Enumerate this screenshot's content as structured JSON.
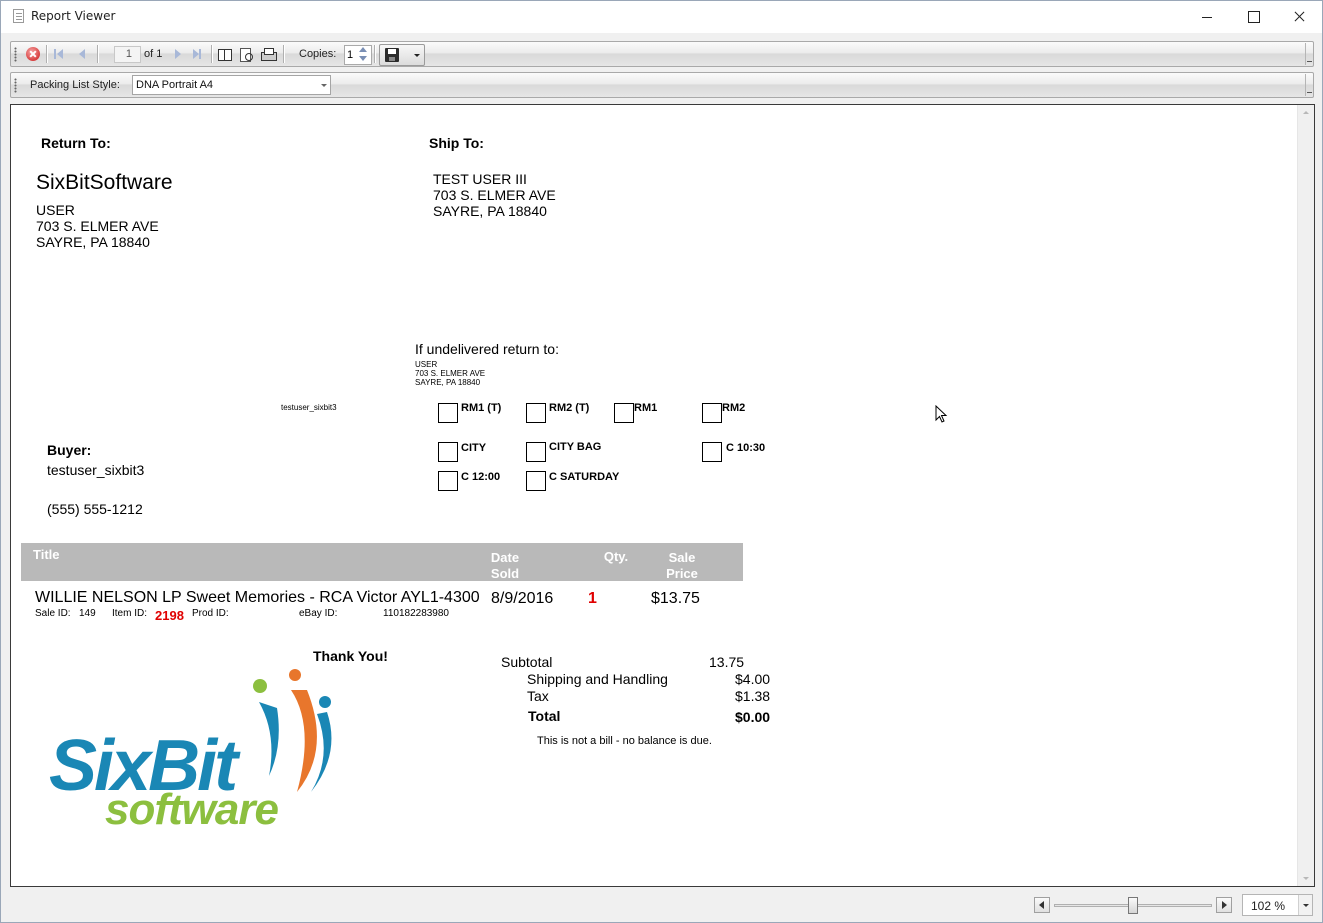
{
  "window": {
    "title": "Report Viewer"
  },
  "toolbar": {
    "page_current": "1",
    "page_of": "of 1",
    "copies_label": "Copies:",
    "copies_value": "1",
    "icons": [
      "stop-icon",
      "first-page-icon",
      "previous-page-icon",
      "next-page-icon",
      "last-page-icon",
      "table-of-contents-icon",
      "page-setup-icon",
      "print-icon",
      "save-icon"
    ]
  },
  "parameters": {
    "style_label": "Packing List Style:",
    "style_value": "DNA Portrait A4"
  },
  "report": {
    "return_to": {
      "heading": "Return To:",
      "company": "SixBitSoftware",
      "name": "USER",
      "street": "703 S. ELMER AVE",
      "city": "SAYRE, PA 18840"
    },
    "ship_to": {
      "heading": "Ship To:",
      "name": "TEST USER III",
      "street": "703 S. ELMER AVE",
      "city": "SAYRE, PA 18840"
    },
    "undelivered": {
      "heading": "If undelivered return to:",
      "name": "USER",
      "street": "703 S. ELMER AVE",
      "city": "SAYRE, PA 18840"
    },
    "buyer_userid_small": "testuser_sixbit3",
    "checkboxes": {
      "rm1t": "RM1 (T)",
      "rm2t": "RM2 (T)",
      "rm1": "RM1",
      "rm2": "RM2",
      "city": "CITY",
      "city_bag": "CITY BAG",
      "c1030": "C 10:30",
      "c1200": "C 12:00",
      "c_saturday": "C SATURDAY"
    },
    "buyer": {
      "heading": "Buyer:",
      "userid": "testuser_sixbit3",
      "phone": "(555) 555-1212"
    },
    "table": {
      "headers": {
        "title": "Title",
        "date_line1": "Date",
        "date_line2": "Sold",
        "qty": "Qty.",
        "price_line1": "Sale",
        "price_line2": "Price"
      },
      "rows": [
        {
          "title": "WILLIE NELSON LP Sweet Memories - RCA Victor AYL1-4300",
          "date_sold": "8/9/2016",
          "qty": "1",
          "price": "$13.75",
          "sale_id_label": "Sale ID:",
          "sale_id": "149",
          "item_id_label": "Item ID:",
          "item_id": "2198",
          "prod_id_label": "Prod ID:",
          "prod_id": "",
          "ebay_id_label": "eBay ID:",
          "ebay_id": "110182283980"
        }
      ]
    },
    "thank_you": "Thank You!",
    "totals": {
      "subtotal_label": "Subtotal",
      "subtotal": "13.75",
      "shipping_label": "Shipping and Handling",
      "shipping": "$4.00",
      "tax_label": "Tax",
      "tax": "$1.38",
      "total_label": "Total",
      "total": "$0.00",
      "note": "This is not a bill - no balance is due."
    },
    "logo": {
      "word1": "SixBit",
      "word2": "software"
    }
  },
  "zoom": {
    "value": "102 %",
    "slider_fraction": 0.5
  },
  "colors": {
    "accent_red": "#e00000",
    "table_header_bg": "#b9b9b9",
    "logo_blue": "#1a87b5",
    "logo_green": "#8cbf3f",
    "logo_orange": "#e8762c"
  }
}
